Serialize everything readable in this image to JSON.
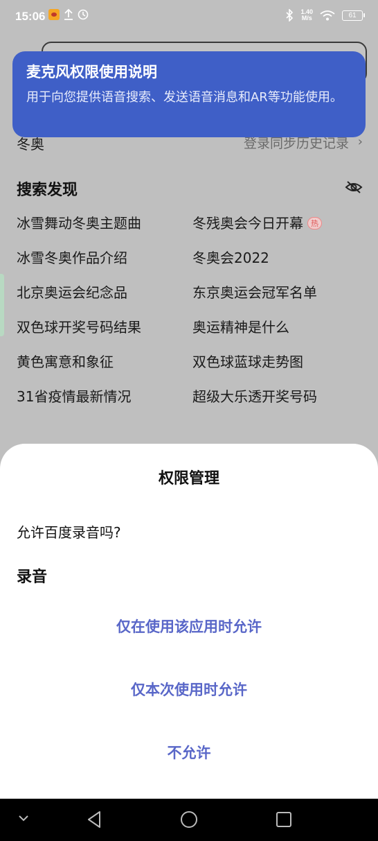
{
  "status_bar": {
    "time": "15:06",
    "net_speed_value": "1.40",
    "net_speed_unit": "M/s",
    "battery": "61"
  },
  "history": {
    "tag": "冬奥",
    "login_sync": "登录同步历史记录",
    "chevron": "›"
  },
  "discover": {
    "title": "搜索发现",
    "items": [
      {
        "text": "冰雪舞动冬奥主题曲",
        "hot": false
      },
      {
        "text": "冬残奥会今日开幕",
        "hot": true,
        "badge": "热"
      },
      {
        "text": "冰雪冬奥作品介绍",
        "hot": false
      },
      {
        "text": "冬奥会2022",
        "hot": false
      },
      {
        "text": "北京奥运会纪念品",
        "hot": false
      },
      {
        "text": "东京奥运会冠军名单",
        "hot": false
      },
      {
        "text": "双色球开奖号码结果",
        "hot": false
      },
      {
        "text": "奥运精神是什么",
        "hot": false
      },
      {
        "text": "黄色寓意和象征",
        "hot": false
      },
      {
        "text": "双色球蓝球走势图",
        "hot": false
      },
      {
        "text": "31省疫情最新情况",
        "hot": false
      },
      {
        "text": "超级大乐透开奖号码",
        "hot": false
      }
    ]
  },
  "mic_banner": {
    "title": "麦克风权限使用说明",
    "description": "用于向您提供语音搜索、发送语音消息和AR等功能使用。"
  },
  "permission_sheet": {
    "title": "权限管理",
    "question": "允许百度录音吗?",
    "permission": "录音",
    "options": [
      "仅在使用该应用时允许",
      "仅本次使用时允许",
      "不允许"
    ]
  },
  "colors": {
    "banner_bg": "#3f5fc7",
    "option_text": "#5967c8",
    "hot_badge": "#e05a5a"
  }
}
